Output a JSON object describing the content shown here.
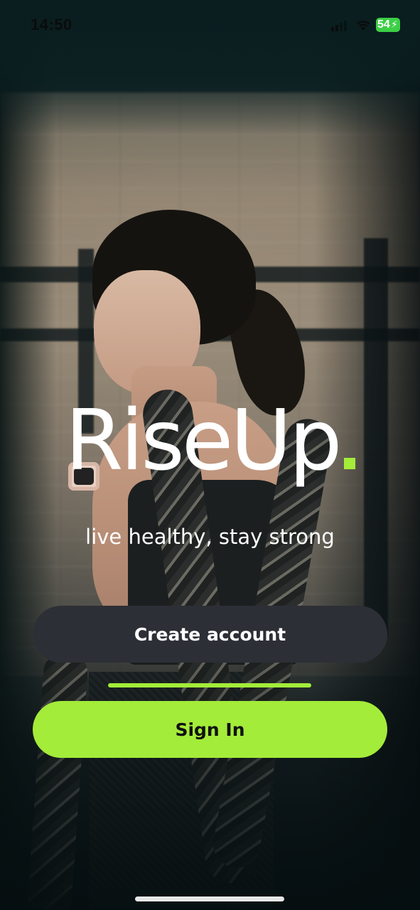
{
  "status_bar": {
    "time": "14:50",
    "battery_level": "54",
    "icons": [
      "signal-icon",
      "wifi-icon",
      "battery-icon",
      "charging-bolt-icon"
    ]
  },
  "brand": {
    "name": "RiseUp",
    "accent_color": "#a3ec3a"
  },
  "tagline": "live healthy, stay strong",
  "buttons": {
    "create_account": "Create account",
    "sign_in": "Sign In"
  },
  "colors": {
    "create_button_bg": "#2d2f36",
    "sign_in_button_bg": "#a3ec3a",
    "battery": "#3ccf46"
  }
}
